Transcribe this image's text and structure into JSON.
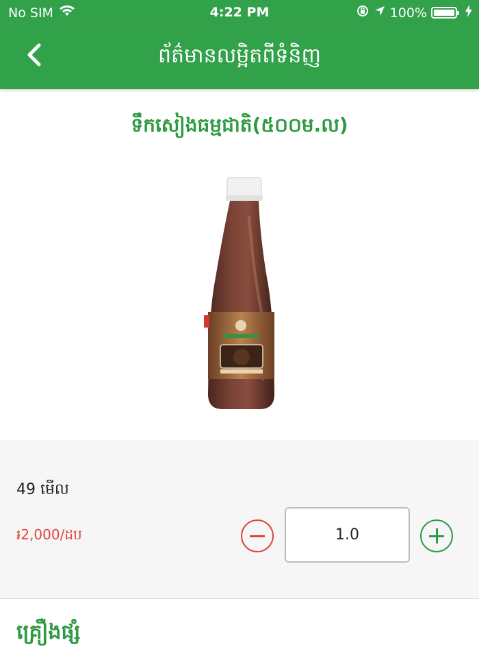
{
  "status_bar": {
    "carrier": "No SIM",
    "time": "4:22 PM",
    "battery": "100%",
    "icons": [
      "wifi-icon",
      "rotation-lock-icon",
      "location-arrow-icon",
      "battery-icon",
      "charging-bolt-icon"
    ]
  },
  "nav": {
    "title": "ព័ត៌មានលម្អិតពីទំនិញ",
    "back_icon": "chevron-left-icon"
  },
  "product": {
    "title": "ទឹកសៀងធម្មជាតិ(៥០០ម.ល)",
    "views": "49 មើល",
    "price": "៛2,000/ដប"
  },
  "quantity": {
    "value": "1.0",
    "minus_icon": "minus-icon",
    "plus_icon": "plus-icon"
  },
  "section": {
    "heading": "គ្រឿងផ្សំ"
  },
  "colors": {
    "primary_green": "#31a24a",
    "accent_green": "#2f9a43",
    "price_red": "#e0443a"
  }
}
